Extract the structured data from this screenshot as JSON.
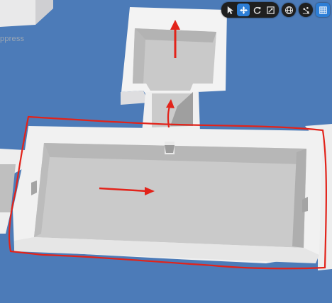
{
  "viewport": {
    "background_label": "ppress"
  },
  "toolbar": {
    "transform_tools": [
      {
        "icon": "select-cursor-icon",
        "active": false
      },
      {
        "icon": "translate-move-icon",
        "active": true
      },
      {
        "icon": "rotate-icon",
        "active": false
      },
      {
        "icon": "scale-icon",
        "active": false
      }
    ],
    "world_local_icon": "globe-icon",
    "surface_snap_icon": "surface-snapping-icon",
    "grid_snap_icon": "grid-snap-icon"
  },
  "colors": {
    "sky": "#4c7bb8",
    "annotation": "#e2231a",
    "toolbar_bg": "#1f1f1f",
    "active_tool": "#2d7ed6"
  }
}
